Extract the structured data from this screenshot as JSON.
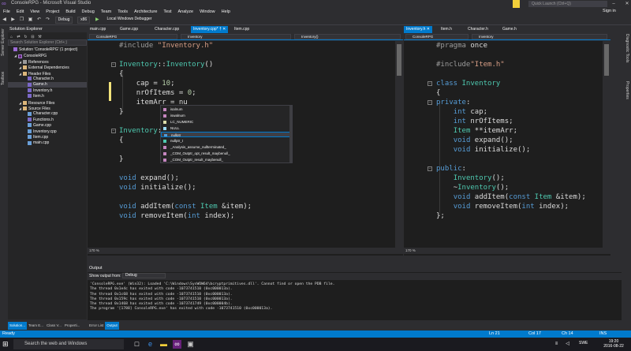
{
  "window": {
    "title": "ConsoleRPG - Microsoft Visual Studio",
    "quick_launch": "Quick Launch (Ctrl+Q)",
    "sign_in": "Sign in"
  },
  "menu": [
    "File",
    "Edit",
    "View",
    "Project",
    "Build",
    "Debug",
    "Team",
    "Tools",
    "Architecture",
    "Test",
    "Analyze",
    "Window",
    "Help"
  ],
  "toolbar": {
    "config": "Debug",
    "platform": "x86",
    "run": "Local Windows Debugger"
  },
  "left_strip": [
    "Server Explorer",
    "Toolbox"
  ],
  "right_strip": [
    "Diagnostic Tools",
    "Properties"
  ],
  "solution_explorer": {
    "title": "Solution Explorer",
    "search_placeholder": "Search Solution Explorer (Ctrl+;)",
    "tree": [
      {
        "label": "Solution 'ConsoleRPG' (1 project)",
        "icon": "solution-icon",
        "depth": 0
      },
      {
        "label": "ConsoleRPG",
        "icon": "project-icon",
        "depth": 1
      },
      {
        "label": "References",
        "icon": "references-icon",
        "depth": 2
      },
      {
        "label": "External Dependencies",
        "icon": "folder-icon",
        "depth": 2
      },
      {
        "label": "Header Files",
        "icon": "folder-icon",
        "depth": 2
      },
      {
        "label": "Character.h",
        "icon": "header-file-icon",
        "depth": 3
      },
      {
        "label": "Game.h",
        "icon": "header-file-icon",
        "depth": 3,
        "selected": true
      },
      {
        "label": "Inventory.h",
        "icon": "header-file-icon",
        "depth": 3
      },
      {
        "label": "Item.h",
        "icon": "header-file-icon",
        "depth": 3
      },
      {
        "label": "Resource Files",
        "icon": "folder-icon",
        "depth": 2
      },
      {
        "label": "Source Files",
        "icon": "folder-icon",
        "depth": 2
      },
      {
        "label": "Character.cpp",
        "icon": "cpp-file-icon",
        "depth": 3
      },
      {
        "label": "Functions.h",
        "icon": "header-file-icon",
        "depth": 3
      },
      {
        "label": "Game.cpp",
        "icon": "cpp-file-icon",
        "depth": 3
      },
      {
        "label": "Inventory.cpp",
        "icon": "cpp-file-icon",
        "depth": 3
      },
      {
        "label": "Item.cpp",
        "icon": "cpp-file-icon",
        "depth": 3
      },
      {
        "label": "main.cpp",
        "icon": "cpp-file-icon",
        "depth": 3
      }
    ],
    "bottom_tabs": [
      "Solution...",
      "Team E...",
      "Class V...",
      "Properti..."
    ]
  },
  "editor_left": {
    "tabs": [
      "main.cpp",
      "Game.cpp",
      "Character.cpp",
      "Inventory.cpp*",
      "Item.cpp"
    ],
    "active_tab": 3,
    "nav": [
      "ConsoleRPG",
      "Inventory",
      "Inventory()"
    ],
    "lines": [
      "#include \"Inventory.h\"",
      "",
      "Inventory::Inventory()",
      "{",
      "    cap = 10;",
      "    nrOfItems = 0;",
      "    itemArr = nu",
      "}",
      "",
      "Inventory::~In",
      "{",
      "",
      "}",
      "",
      "void expand();",
      "void initialize();",
      "",
      "void addItem(const Item &item);",
      "void removeItem(int index);"
    ],
    "zoom": "170 %"
  },
  "autocomplete": {
    "items": [
      "isalnum",
      "iswalnum",
      "LC_NUMERIC",
      "NULL",
      "nullptr",
      "nullptr_t",
      "_Analysis_assume_nullterminated_",
      "_COM_Outptr_opt_result_maybenull_",
      "_COM_Outptr_result_maybenull_"
    ],
    "selected": 4
  },
  "editor_right": {
    "tabs": [
      "Inventory.h",
      "Item.h",
      "Character.h",
      "Game.h"
    ],
    "active_tab": 0,
    "nav": [
      "ConsoleRPG",
      "Inventory"
    ],
    "lines": [
      "#pragma once",
      "",
      "#include\"Item.h\"",
      "",
      "class Inventory",
      "{",
      "private:",
      "    int cap;",
      "    int nrOfItems;",
      "    Item **itemArr;",
      "    void expand();",
      "    void initialize();",
      "",
      "public:",
      "    Inventory();",
      "    ~Inventory();",
      "    void addItem(const Item &item);",
      "    void removeItem(int index);",
      "};"
    ],
    "zoom": "170 %"
  },
  "output": {
    "title": "Output",
    "show_from_label": "Show output from:",
    "source": "Debug",
    "lines": [
      "'ConsoleRPG.exe' (Win32): Loaded 'C:\\Windows\\SysWOW64\\bcryptprimitives.dll'. Cannot find or open the PDB file.",
      "The thread 0x1e4c has exited with code -1073741510 (0xc000013a).",
      "The thread 0x1c68 has exited with code -1073741510 (0xc000013a).",
      "The thread 0x159c has exited with code -1073741510 (0xc000013a).",
      "The thread 0x1468 has exited with code -1073741749 (0xc000004b).",
      "The program '[1788] ConsoleRPG.exe' has exited with code -1073741510 (0xc000013a)."
    ],
    "bottom_tabs": [
      "Error List",
      "Output"
    ]
  },
  "status": {
    "left": "Ready",
    "ln": "Ln 21",
    "col": "Col 17",
    "ch": "Ch 14",
    "ins": "INS"
  },
  "taskbar": {
    "search": "Search the web and Windows",
    "lang": "SWE",
    "time": "19:20",
    "date": "2016-08-22"
  },
  "colors": {
    "accent": "#007acc",
    "keyword": "#569cd6",
    "type": "#4ec9b0",
    "string": "#d69d85"
  }
}
